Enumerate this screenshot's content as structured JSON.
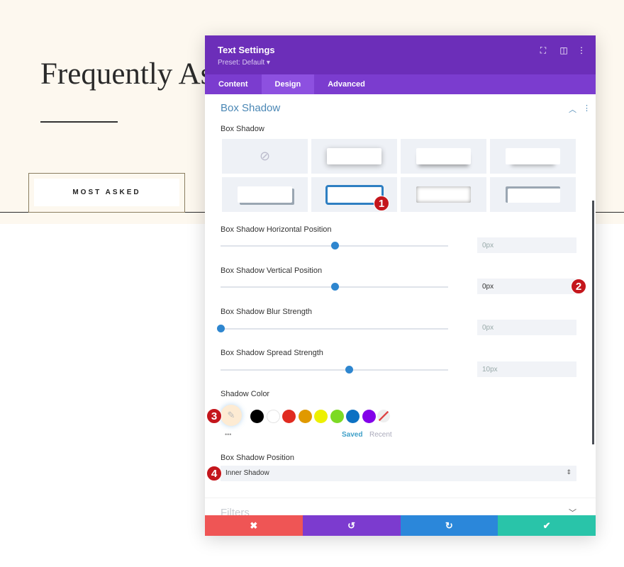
{
  "page": {
    "title": "Frequently As",
    "button": "MOST ASKED"
  },
  "modal": {
    "title": "Text Settings",
    "preset": "Preset: Default ▾",
    "header_icons": [
      "fullscreen-icon",
      "split-view-icon",
      "more-icon"
    ],
    "tabs": [
      {
        "label": "Content"
      },
      {
        "label": "Design",
        "active": true
      },
      {
        "label": "Advanced"
      }
    ],
    "section": "Box Shadow",
    "box_shadow_label": "Box Shadow",
    "presets_selected": 5,
    "sliders": [
      {
        "label": "Box Shadow Horizontal Position",
        "value": "0px",
        "fraction": 0.5
      },
      {
        "label": "Box Shadow Vertical Position",
        "value": "0px",
        "fraction": 0.5
      },
      {
        "label": "Box Shadow Blur Strength",
        "value": "0px",
        "fraction": 0
      },
      {
        "label": "Box Shadow Spread Strength",
        "value": "10px",
        "fraction": 0.5625
      }
    ],
    "shadow_color_label": "Shadow Color",
    "swatches": [
      "#000000",
      "#ffffff",
      "#e02b20",
      "#e09900",
      "#edf000",
      "#7cda24",
      "#0c71c3",
      "#8300e9"
    ],
    "saved": "Saved",
    "recent": "Recent",
    "more": "•••",
    "position_label": "Box Shadow Position",
    "position_value": "Inner Shadow",
    "next_section": "Filters",
    "footer": {
      "cancel": "✖",
      "undo": "↺",
      "redo": "↻",
      "save": "✔"
    },
    "colors": {
      "header": "#6c2eb9",
      "cancel": "#ef5555",
      "undo": "#7c3bcf",
      "redo": "#2b87da",
      "save": "#29c4a9"
    }
  },
  "badges": [
    "1",
    "2",
    "3",
    "4"
  ]
}
